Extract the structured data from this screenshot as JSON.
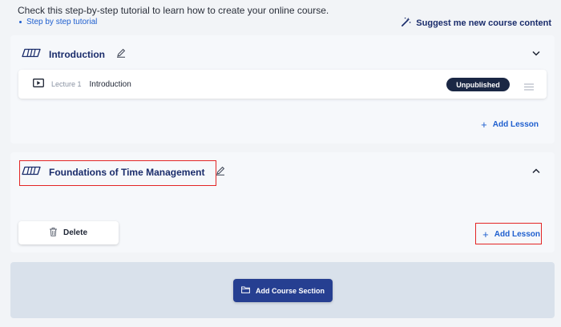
{
  "header": {
    "intro_text": "Check this step-by-step tutorial to learn how to create your online course.",
    "tutorial_link": "Step by step tutorial",
    "suggest_label": "Suggest me new course content",
    "suggest_icon": "magic-wand-icon"
  },
  "sections": [
    {
      "title": "Introduction",
      "icon": "book-icon",
      "expanded": false,
      "lectures": [
        {
          "number_label": "Lecture 1",
          "title": "Introduction",
          "status": "Unpublished",
          "icon": "play-icon"
        }
      ],
      "add_lesson_label": "Add Lesson"
    },
    {
      "title": "Foundations of Time Management",
      "icon": "book-icon",
      "expanded": true,
      "delete_label": "Delete",
      "add_lesson_label": "Add Lesson"
    }
  ],
  "add_course_section_label": "Add Course Section",
  "colors": {
    "accent": "#1f5fcf",
    "navy": "#1a2c6b",
    "badge": "#1a2744",
    "primary_button": "#263f91",
    "highlight": "#e32525"
  }
}
